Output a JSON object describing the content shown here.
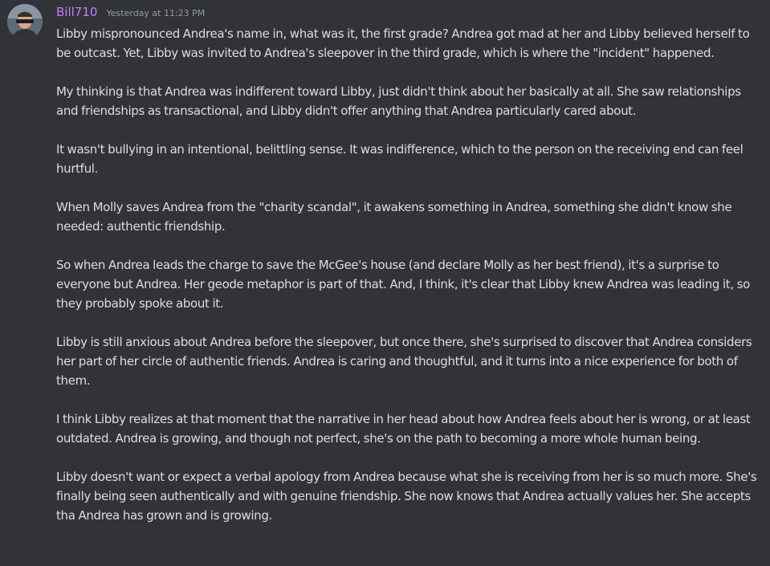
{
  "message": {
    "username": "Bill710",
    "username_color": "#c77dff",
    "timestamp": "Yesterday at 11:23 PM",
    "avatar_icon": "user-avatar-icon",
    "paragraphs": [
      "Libby mispronounced Andrea's name in, what was it, the first grade? Andrea got mad at her and Libby believed herself to be outcast. Yet, Libby was invited to Andrea's sleepover in the third grade, which is where the \"incident\" happened.",
      "My thinking is that Andrea was indifferent toward Libby, just didn't think about her basically at all. She saw relationships and friendships as transactional, and Libby didn't offer anything that Andrea particularly cared about.",
      "It wasn't bullying in an intentional, belittling sense. It was indifference, which to the person on the receiving end can feel hurtful.",
      "When Molly saves Andrea from the \"charity scandal\", it awakens something in Andrea, something she didn't know she needed: authentic friendship.",
      "So when Andrea leads the charge to save the McGee's house (and declare Molly as her best friend), it's a surprise to everyone but Andrea. Her geode metaphor is part of that. And, I think, it's clear that Libby knew Andrea was leading it, so they probably spoke about it.",
      "Libby is still anxious about Andrea before the sleepover, but once there, she's surprised to discover that Andrea considers her part of her circle of authentic friends. Andrea is caring and thoughtful, and it turns into a nice experience for both of them.",
      "I think Libby realizes at that moment that the narrative in her head about how Andrea feels about her is wrong, or at least outdated. Andrea is growing, and though not perfect, she's on the path to becoming a more whole human being.",
      "Libby doesn't want or expect a verbal apology from Andrea because what she is receiving from her is so much more. She's finally being seen authentically and with genuine friendship. She now knows that Andrea actually values her. She accepts tha Andrea has grown and is growing."
    ]
  },
  "colors": {
    "background": "#313338",
    "text": "#dbdee1",
    "timestamp": "#949ba4"
  }
}
